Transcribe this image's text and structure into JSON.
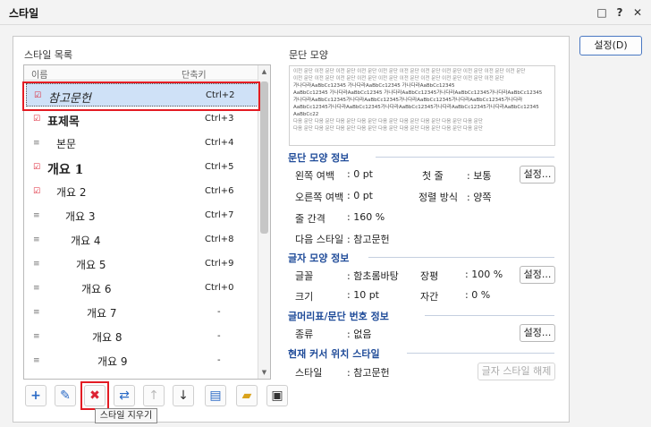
{
  "window": {
    "title": "스타일",
    "buttons": [
      "□",
      "?",
      "✕"
    ]
  },
  "actions": {
    "settings_button": "설정(D)"
  },
  "style_list": {
    "label": "스타일 목록",
    "columns": [
      "이름",
      "단축키"
    ],
    "items": [
      {
        "name": "참고문헌",
        "shortcut": "Ctrl+2",
        "selected": true
      },
      {
        "name": "표제목",
        "shortcut": "Ctrl+3"
      },
      {
        "name": "본문",
        "shortcut": "Ctrl+4"
      },
      {
        "name": "개요 1",
        "shortcut": "Ctrl+5"
      },
      {
        "name": "개요 2",
        "shortcut": "Ctrl+6"
      },
      {
        "name": "개요 3",
        "shortcut": "Ctrl+7"
      },
      {
        "name": "개요 4",
        "shortcut": "Ctrl+8"
      },
      {
        "name": "개요 5",
        "shortcut": "Ctrl+9"
      },
      {
        "name": "개요 6",
        "shortcut": "Ctrl+0"
      },
      {
        "name": "개요 7",
        "shortcut": "-"
      },
      {
        "name": "개요 8",
        "shortcut": "-"
      },
      {
        "name": "개요 9",
        "shortcut": "-"
      }
    ]
  },
  "preview": {
    "label": "문단 모양",
    "lines": [
      "이전 문단 이전 문단 이전 문단 이전 문단 이전 문단 이전 문단 이전 문단 이전 문단 이전 문단 이전 문단 이전 문단",
      "이전 문단 이전 문단 이전 문단 이전 문단 이전 문단 이전 문단 이전 문단 이전 문단 이전 문단 이전 문단",
      "가나다라AaBbCc12345        가나다라AaBbCc12345        가나다라AaBbCc12345",
      "AaBbCc12345 가나다라AaBbCc12345 가나다라AaBbCc12345가나다라AaBbCc12345가나다라AaBbCc12345",
      "가나다라AaBbCc12345가나다라AaBbCc12345가나다라AaBbCc12345가나다라AaBbCc12345가나다라",
      "AaBbCc12345가나다라AaBbCc12345가나다라AaBbCc12345가나다라AaBbCc12345가나다라AaBbCc12345",
      "AaBbCc22",
      "다음 문단 다음 문단 다음 문단 다음 문단 다음 문단 다음 문단 다음 문단 다음 문단 다음 문단",
      "다음 문단 다음 문단 다음 문단 다음 문단 다음 문단 다음 문단 다음 문단 다음 문단 다음 문단"
    ]
  },
  "para_info": {
    "title": "문단 모양 정보",
    "left_margin_label": "왼쪽 여백",
    "left_margin_value": ": 0 pt",
    "indent_label": "첫 줄",
    "indent_value": ": 보통",
    "right_margin_label": "오른쪽 여백",
    "right_margin_value": ": 0 pt",
    "align_label": "정렬 방식",
    "align_value": ": 양쪽",
    "line_spacing_label": "줄 간격",
    "line_spacing_value": ": 160 %",
    "next_style_label": "다음 스타일",
    "next_style_value": ": 참고문헌",
    "settings_label": "설정..."
  },
  "char_info": {
    "title": "글자 모양 정보",
    "font_label": "글꼴",
    "font_value": ": 함초롬바탕",
    "width_label": "장평",
    "width_value": ": 100 %",
    "size_label": "크기",
    "size_value": ": 10 pt",
    "spacing_label": "자간",
    "spacing_value": ": 0 %",
    "settings_label": "설정..."
  },
  "numbering_info": {
    "title": "글머리표/문단 번호 정보",
    "type_label": "종류",
    "type_value": ": 없음",
    "settings_label": "설정..."
  },
  "cursor_style": {
    "title": "현재 커서 위치 스타일",
    "style_label": "스타일",
    "style_value": ": 참고문헌",
    "clear_button": "글자 스타일 해제"
  },
  "toolbar": {
    "tooltip": "스타일 지우기"
  },
  "colors": {
    "accent": "#1f4b99",
    "highlight_red": "#e31b23",
    "selection_bg": "#cfe1f7"
  }
}
